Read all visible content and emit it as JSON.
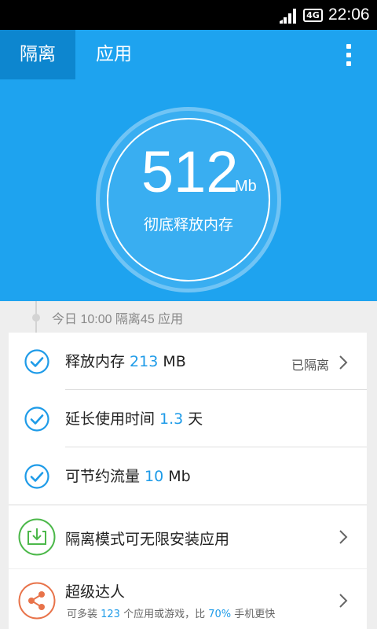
{
  "status_bar": {
    "network": "4G",
    "time": "22:06"
  },
  "header": {
    "tabs": [
      {
        "label": "隔离",
        "active": true
      },
      {
        "label": "应用",
        "active": false
      }
    ]
  },
  "hero": {
    "value": "512",
    "unit": "Mb",
    "caption": "彻底释放内存"
  },
  "timeline": {
    "text": "今日 10:00  隔离45 应用"
  },
  "results": [
    {
      "prefix": "释放内存 ",
      "value": "213",
      "suffix": " MB",
      "status": "已隔离"
    },
    {
      "prefix": "延长使用时间 ",
      "value": "1.3",
      "suffix": " 天"
    },
    {
      "prefix": "可节约流量 ",
      "value": "10",
      "suffix": " Mb"
    }
  ],
  "isolation_mode": {
    "title": "隔离模式可无限安装应用"
  },
  "expert": {
    "title": "超级达人",
    "sub_prefix": "可多装 ",
    "sub_apps": "123",
    "sub_middle": " 个应用或游戏，比 ",
    "sub_percent": "70%",
    "sub_suffix": " 手机更快"
  },
  "colors": {
    "primary": "#1ea3ef",
    "tab_active": "#0d86cf",
    "check": "#1e9be8",
    "download_green": "#4cb84a",
    "share_orange": "#e8734a"
  }
}
